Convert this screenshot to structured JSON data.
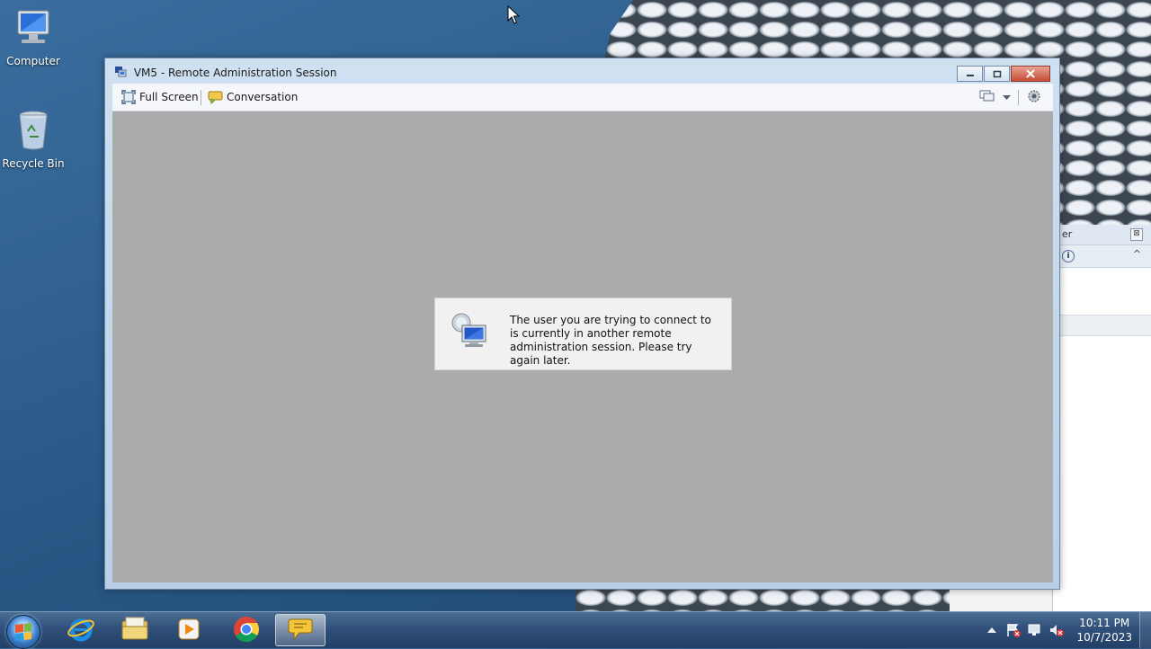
{
  "desktop": {
    "icons": [
      {
        "label": "Computer",
        "icon": "computer-icon"
      },
      {
        "label": "Recycle Bin",
        "icon": "recycle-bin-icon"
      }
    ]
  },
  "background_window": {
    "title_fragment": "er",
    "close_glyph": "⊠",
    "info_glyph": "i",
    "caret_glyph": "^"
  },
  "window": {
    "title": "VM5 - Remote Administration Session",
    "toolbar": {
      "fullscreen_label": "Full Screen",
      "conversation_label": "Conversation"
    },
    "message": "The user you are trying to connect to is currently in another remote administration session. Please try again later."
  },
  "taskbar": {
    "pinned": [
      "internet-explorer-icon",
      "windows-explorer-icon",
      "media-player-icon",
      "chrome-icon",
      "chat-icon"
    ],
    "active": "chat-icon",
    "clock": {
      "time": "10:11 PM",
      "date": "10/7/2023"
    }
  },
  "colors": {
    "desktop_blue": "#2f5f8e",
    "session_bg": "#ababab",
    "close_red": "#c84d36"
  }
}
